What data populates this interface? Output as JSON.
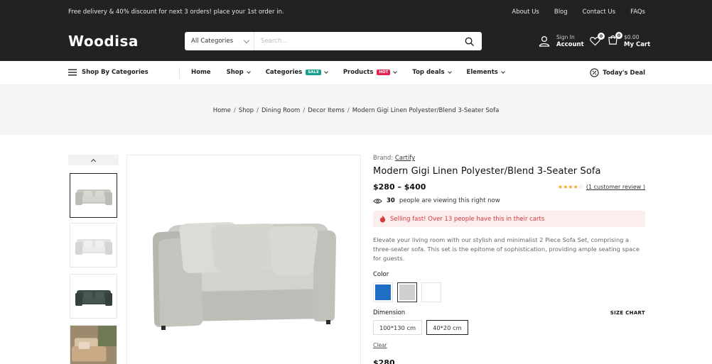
{
  "topbar": {
    "promo": "Free delivery & 40% discount for next 3 orders! place your 1st order in.",
    "links": [
      "About Us",
      "Blog",
      "Contact Us",
      "FAQs"
    ]
  },
  "header": {
    "logo": "Woodisa",
    "search": {
      "category": "All Categories",
      "placeholder": "Search..."
    },
    "account": {
      "small": "Sign In",
      "big": "Account"
    },
    "wishlist_count": "0",
    "cart": {
      "count": "0",
      "amount": "$0.00",
      "label": "My Cart"
    }
  },
  "nav": {
    "by_categories": "Shop By Categories",
    "items": [
      {
        "label": "Home"
      },
      {
        "label": "Shop"
      },
      {
        "label": "Categories",
        "tag": "SALE"
      },
      {
        "label": "Products",
        "tag": "HOT"
      },
      {
        "label": "Top deals"
      },
      {
        "label": "Elements"
      }
    ],
    "deal": "Today's Deal"
  },
  "breadcrumb": [
    "Home",
    "Shop",
    "Dining Room",
    "Decor Items",
    "Modern Gigi Linen Polyester/Blend 3-Seater Sofa"
  ],
  "product": {
    "brand_label": "Brand:",
    "brand": "Cartify",
    "title": "Modern Gigi Linen Polyester/Blend 3-Seater Sofa",
    "price_range": "$280 – $400",
    "rating": 4,
    "rating_max": 5,
    "review_text": "(1 customer review )",
    "viewing_count": "30",
    "viewing_text": "people are viewing this right now",
    "alert": "Selling fast! Over 13 people have this in their carts",
    "description": "Elevate your living room with our stylish and minimalist 2 Piece Sofa Set, comprising a three-seater sofa. This set is the epitome of sophistication, providing ample seating space for guests.",
    "color_label": "Color",
    "colors": [
      "#1f6fc5",
      "#cfcfcf",
      "#ffffff"
    ],
    "selected_color_index": 1,
    "dimension_label": "Dimension",
    "size_chart": "SIZE CHART",
    "dimensions": [
      "100*130 cm",
      "40*20 cm"
    ],
    "selected_dimension_index": 1,
    "clear": "Clear",
    "current_price": "$280"
  },
  "colors": {
    "topbar_bg": "#222222",
    "sale_tag": "#14a08f",
    "hot_tag": "#e6224f",
    "alert_text": "#d9363e",
    "alert_bg": "#fdeeee",
    "star": "#f5a623"
  }
}
